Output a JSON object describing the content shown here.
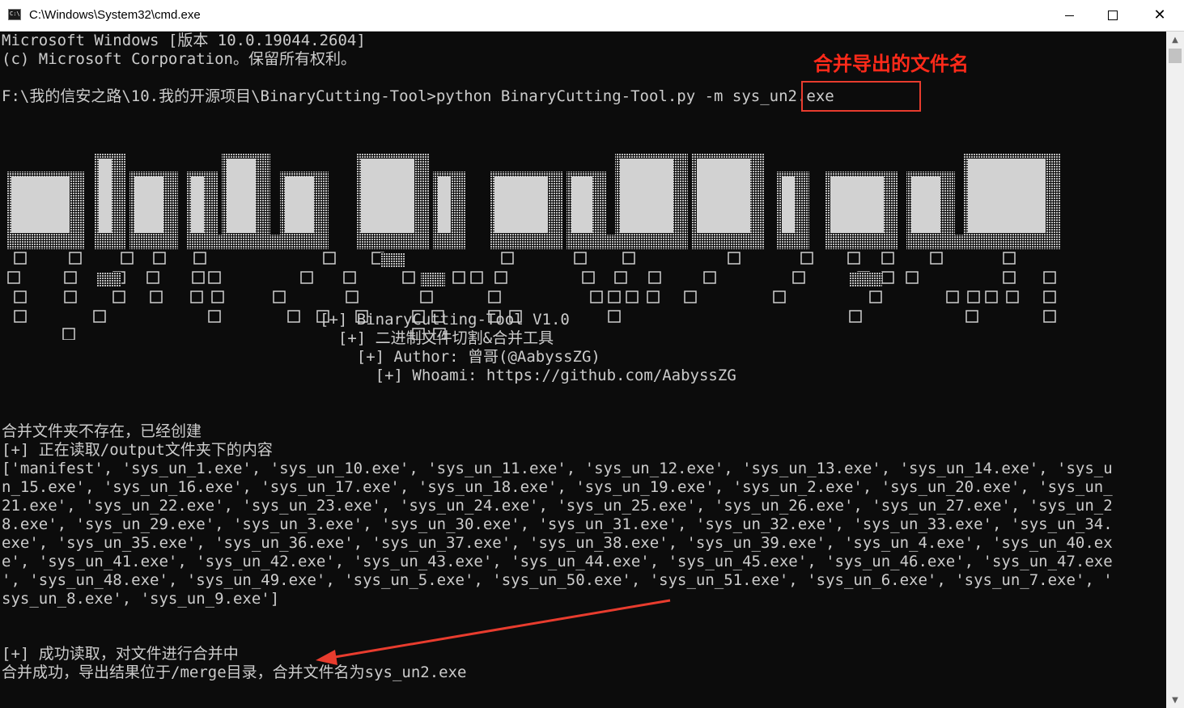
{
  "window": {
    "title": "C:\\Windows\\System32\\cmd.exe",
    "icon": "cmd-app-icon",
    "minimize_label": "",
    "close_label": "✕"
  },
  "console": {
    "header_line1": "Microsoft Windows [版本 10.0.19044.2604]",
    "header_line2": "(c) Microsoft Corporation。保留所有权利。",
    "prompt": "F:\\我的信安之路\\10.我的开源项目\\BinaryCutting-Tool>python BinaryCutting-Tool.py -m ",
    "prompt_arg": "sys_un2.exe",
    "banner": [
      "[+] BinaryCutting-Tool V1.0",
      "  [+] 二进制文件切割&合并工具",
      "    [+] Author: 曾哥(@AabyssZG)",
      "      [+] Whoami: https://github.com/AabyssZG"
    ],
    "output": [
      "合并文件夹不存在，已经创建",
      "[+] 正在读取/output文件夹下的内容",
      "['manifest', 'sys_un_1.exe', 'sys_un_10.exe', 'sys_un_11.exe', 'sys_un_12.exe', 'sys_un_13.exe', 'sys_un_14.exe', 'sys_u",
      "n_15.exe', 'sys_un_16.exe', 'sys_un_17.exe', 'sys_un_18.exe', 'sys_un_19.exe', 'sys_un_2.exe', 'sys_un_20.exe', 'sys_un_",
      "21.exe', 'sys_un_22.exe', 'sys_un_23.exe', 'sys_un_24.exe', 'sys_un_25.exe', 'sys_un_26.exe', 'sys_un_27.exe', 'sys_un_2",
      "8.exe', 'sys_un_29.exe', 'sys_un_3.exe', 'sys_un_30.exe', 'sys_un_31.exe', 'sys_un_32.exe', 'sys_un_33.exe', 'sys_un_34.",
      "exe', 'sys_un_35.exe', 'sys_un_36.exe', 'sys_un_37.exe', 'sys_un_38.exe', 'sys_un_39.exe', 'sys_un_4.exe', 'sys_un_40.ex",
      "e', 'sys_un_41.exe', 'sys_un_42.exe', 'sys_un_43.exe', 'sys_un_44.exe', 'sys_un_45.exe', 'sys_un_46.exe', 'sys_un_47.exe",
      "', 'sys_un_48.exe', 'sys_un_49.exe', 'sys_un_5.exe', 'sys_un_50.exe', 'sys_un_51.exe', 'sys_un_6.exe', 'sys_un_7.exe', '",
      "sys_un_8.exe', 'sys_un_9.exe']"
    ],
    "result_line1": "[+] 成功读取，对文件进行合并中",
    "result_line2": "合并成功，导出结果位于/merge目录，合并文件名为sys_un2.exe"
  },
  "annotation": {
    "label": "合并导出的文件名",
    "color": "#ff2a1a"
  },
  "colors": {
    "console_bg": "#0c0c0c",
    "console_fg": "#cccccc",
    "annotation_red": "#e83c2e"
  }
}
